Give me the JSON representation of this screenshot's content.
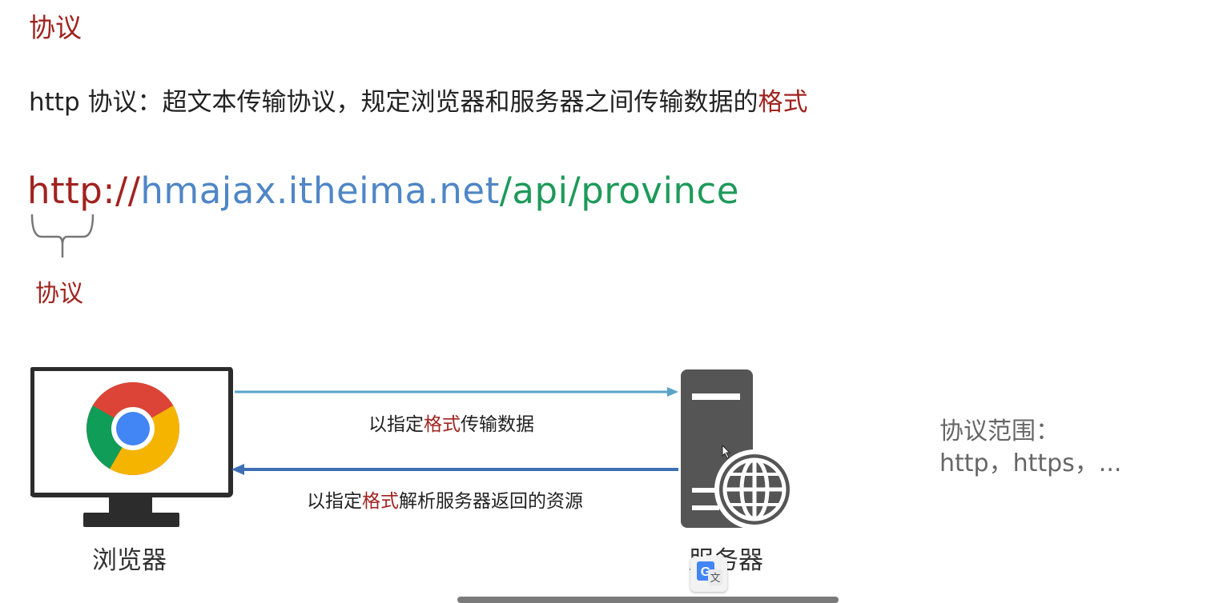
{
  "title": "协议",
  "definition": {
    "prefix": "http 协议：超文本传输协议，规定浏览器和服务器之间传输数据的",
    "highlight": "格式"
  },
  "url": {
    "protocol": "http://",
    "host": "hmajax.itheima.net",
    "path": "/api/province"
  },
  "brace_label": "协议",
  "diagram": {
    "browser_label": "浏览器",
    "server_label": "服务器",
    "request": {
      "before": "以指定",
      "highlight": "格式",
      "after": "传输数据"
    },
    "response": {
      "before": "以指定",
      "highlight": "格式",
      "after": "解析服务器返回的资源"
    }
  },
  "scope": {
    "label": "协议范围：",
    "values": "http，https，..."
  },
  "colors": {
    "accent_red": "#a0231f",
    "url_blue": "#4f86c6",
    "url_green": "#1e9a5a",
    "arrow_top": "#5aa3c8",
    "arrow_bottom": "#3d6fb5"
  },
  "icons": {
    "browser": "chrome-logo",
    "monitor": "monitor-icon",
    "server": "server-icon",
    "globe": "globe-icon",
    "translate": "google-translate-icon"
  }
}
